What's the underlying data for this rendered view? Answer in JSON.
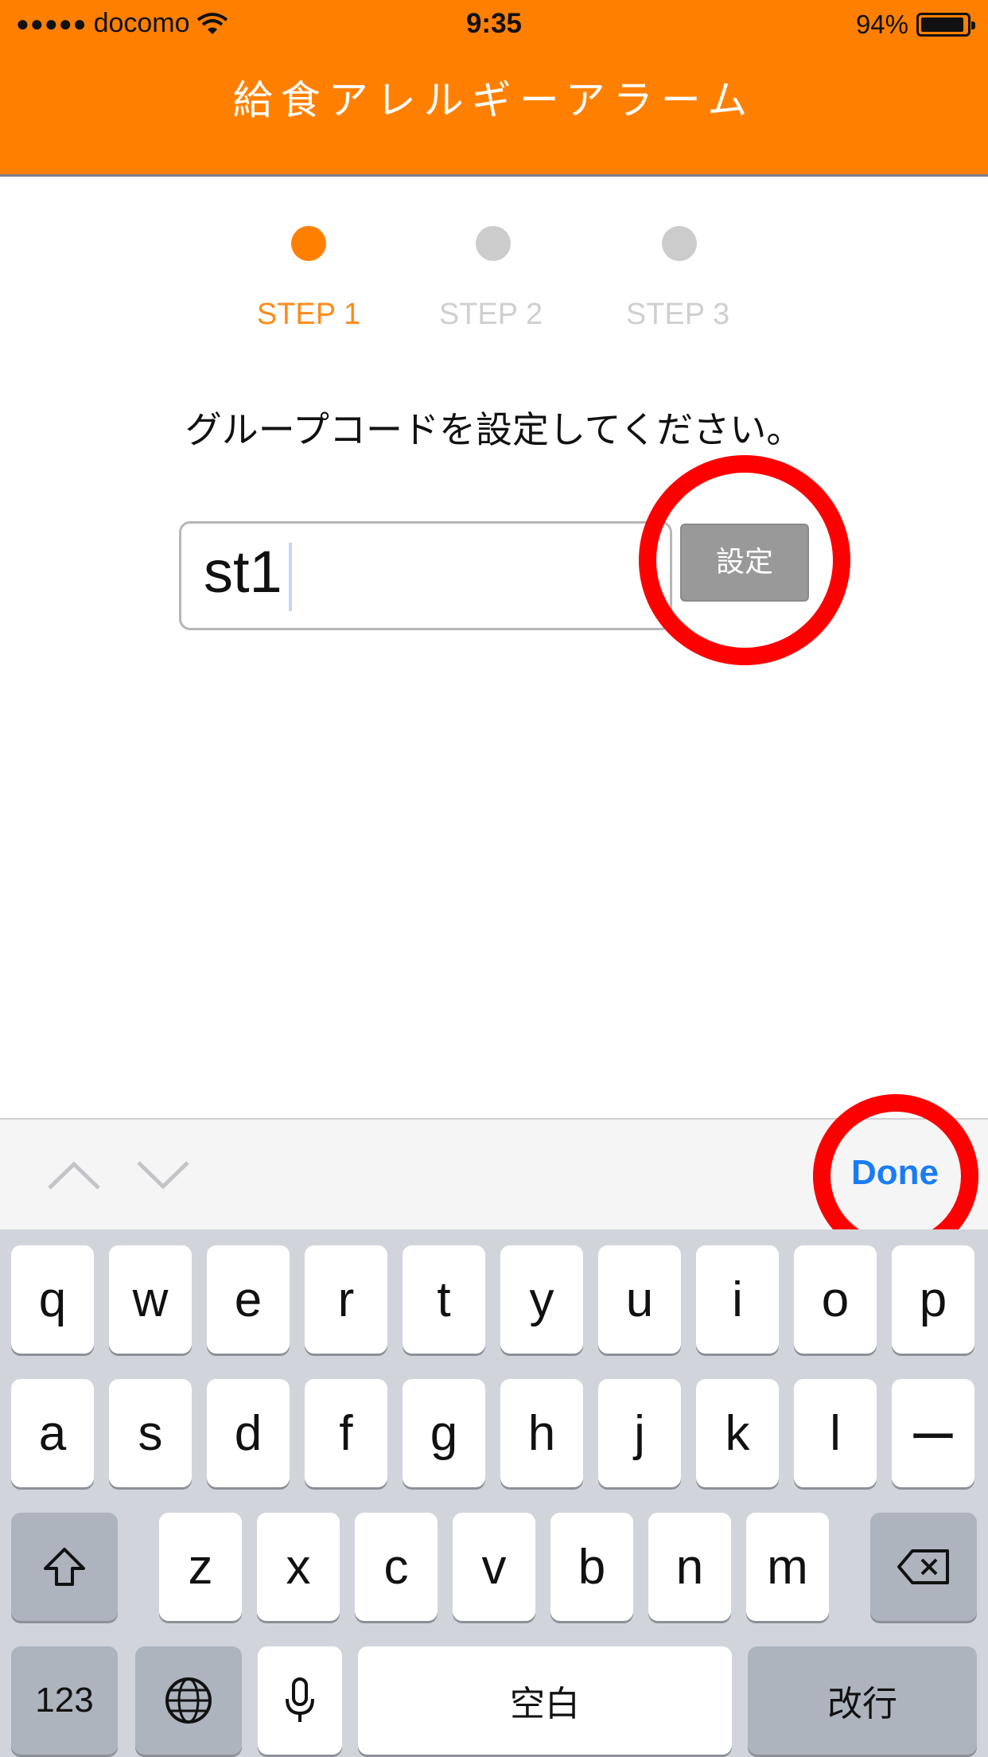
{
  "status_bar": {
    "signal_dots": "●●●●●",
    "carrier": "docomo",
    "time": "9:35",
    "battery_percent": "94%",
    "battery_level": 0.94
  },
  "header": {
    "title": "給食アレルギーアラーム",
    "color": "#ff8000"
  },
  "steps": [
    {
      "label": "STEP 1",
      "active": true
    },
    {
      "label": "STEP 2",
      "active": false
    },
    {
      "label": "STEP 3",
      "active": false
    }
  ],
  "instruction": "グループコードを設定してください。",
  "group_code": {
    "value": "st1"
  },
  "set_button": {
    "label": "設定"
  },
  "accessory_bar": {
    "done_label": "Done"
  },
  "keyboard": {
    "row1": [
      "q",
      "w",
      "e",
      "r",
      "t",
      "y",
      "u",
      "i",
      "o",
      "p"
    ],
    "row2": [
      "a",
      "s",
      "d",
      "f",
      "g",
      "h",
      "j",
      "k",
      "l",
      "ー"
    ],
    "row3": [
      "z",
      "x",
      "c",
      "v",
      "b",
      "n",
      "m"
    ],
    "numbers_label": "123",
    "space_label": "空白",
    "return_label": "改行",
    "icons": [
      "shift-icon",
      "backspace-icon",
      "globe-icon",
      "microphone-icon"
    ]
  },
  "annotation_color": "#ff0000"
}
